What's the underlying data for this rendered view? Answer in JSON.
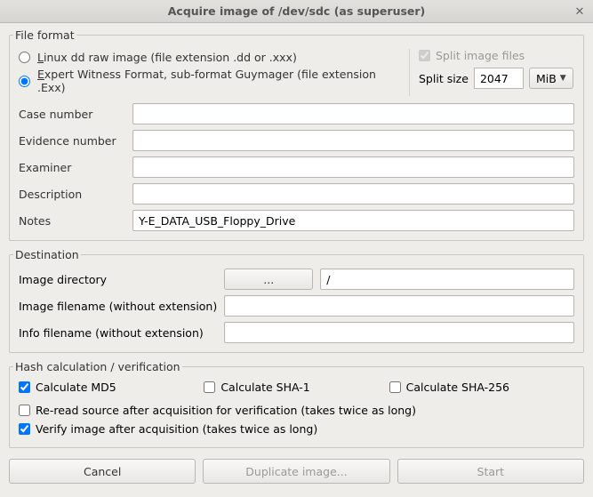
{
  "window": {
    "title": "Acquire image of /dev/sdc (as superuser)"
  },
  "file_format": {
    "legend": "File format",
    "radio_dd": "inux dd raw image (file extension .dd or .xxx)",
    "radio_dd_prefix": "L",
    "radio_ewf": "xpert Witness Format, sub-format Guymager (file extension .Exx)",
    "radio_ewf_prefix": "E",
    "split_images_label": "Split image files",
    "split_size_label": "Split size",
    "split_size_value": "2047",
    "split_unit": "MiB"
  },
  "fields": {
    "case_number_label": "Case number",
    "case_number_value": "",
    "evidence_number_label": "Evidence number",
    "evidence_number_value": "",
    "examiner_label": "Examiner",
    "examiner_value": "",
    "description_label": "Description",
    "description_value": "",
    "notes_label": "Notes",
    "notes_value": "Y-E_DATA_USB_Floppy_Drive"
  },
  "destination": {
    "legend": "Destination",
    "image_directory_label": "Image directory",
    "browse_label": "...",
    "image_directory_value": "/",
    "image_filename_label": "Image filename (without extension)",
    "image_filename_value": "",
    "info_filename_label": "Info filename (without extension)",
    "info_filename_value": ""
  },
  "hash": {
    "legend": "Hash calculation / verification",
    "md5": "Calculate MD5",
    "sha1": "Calculate SHA-1",
    "sha256": "Calculate SHA-256",
    "reread": "Re-read source after acquisition for verification (takes twice as long)",
    "verify": "Verify image after acquisition (takes twice as long)"
  },
  "buttons": {
    "cancel": "Cancel",
    "duplicate": "Duplicate image...",
    "start": "Start"
  }
}
